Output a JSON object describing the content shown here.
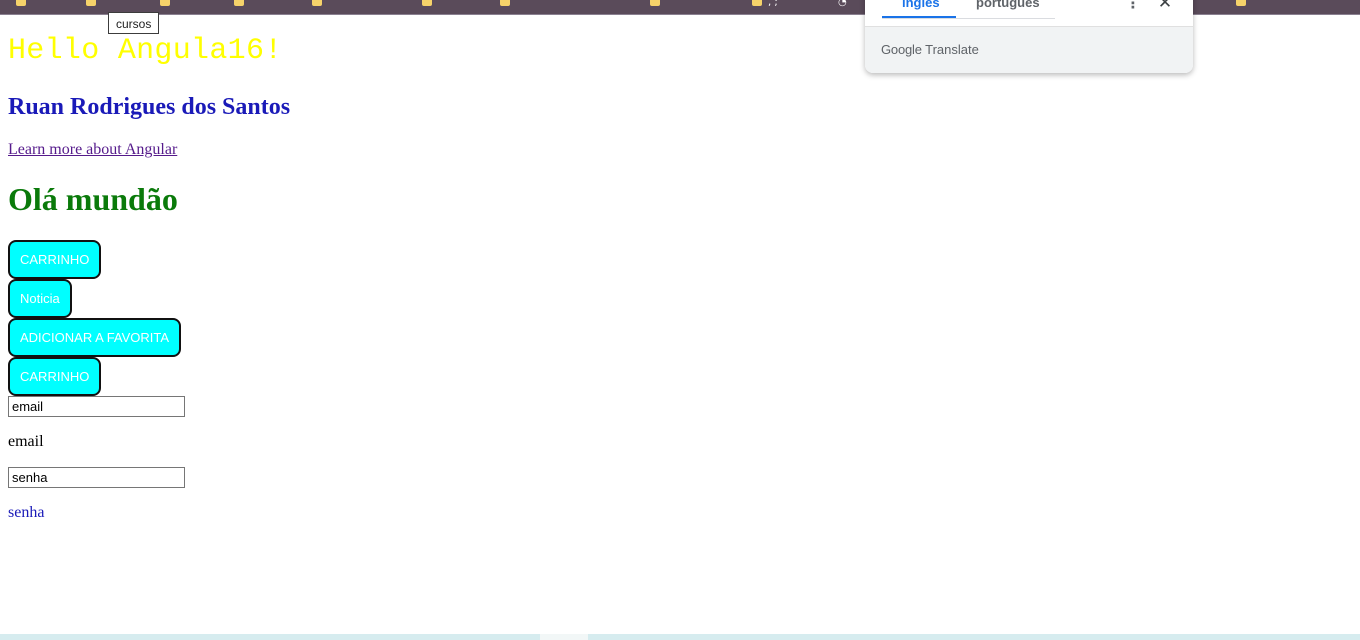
{
  "bookmarks_bar": {
    "tooltip": "cursos"
  },
  "page": {
    "hello_title": "Hello Angula16!",
    "author_name": "Ruan Rodrigues dos Santos",
    "learn_link": "Learn more about Angular",
    "greeting": "Olá mundão",
    "buttons": [
      {
        "label": "CARRINHO"
      },
      {
        "label": "Noticia"
      },
      {
        "label": "ADICIONAR A FAVORITA"
      },
      {
        "label": "CARRINHO"
      }
    ],
    "email_input": {
      "value": "email"
    },
    "email_label": "email",
    "password_input": {
      "value": "senha"
    },
    "password_label": "senha"
  },
  "translate_popup": {
    "tab_source": "inglês",
    "tab_target": "português",
    "more_icon": "more-vert-icon",
    "close_icon": "close-icon",
    "brand_google": "Google",
    "brand_translate": "Translate"
  },
  "colors": {
    "hello": "#ffff00",
    "author": "#1a1ab8",
    "greeting": "#0a7a0a",
    "button_bg": "#00ffff",
    "accent": "#1a73e8"
  }
}
